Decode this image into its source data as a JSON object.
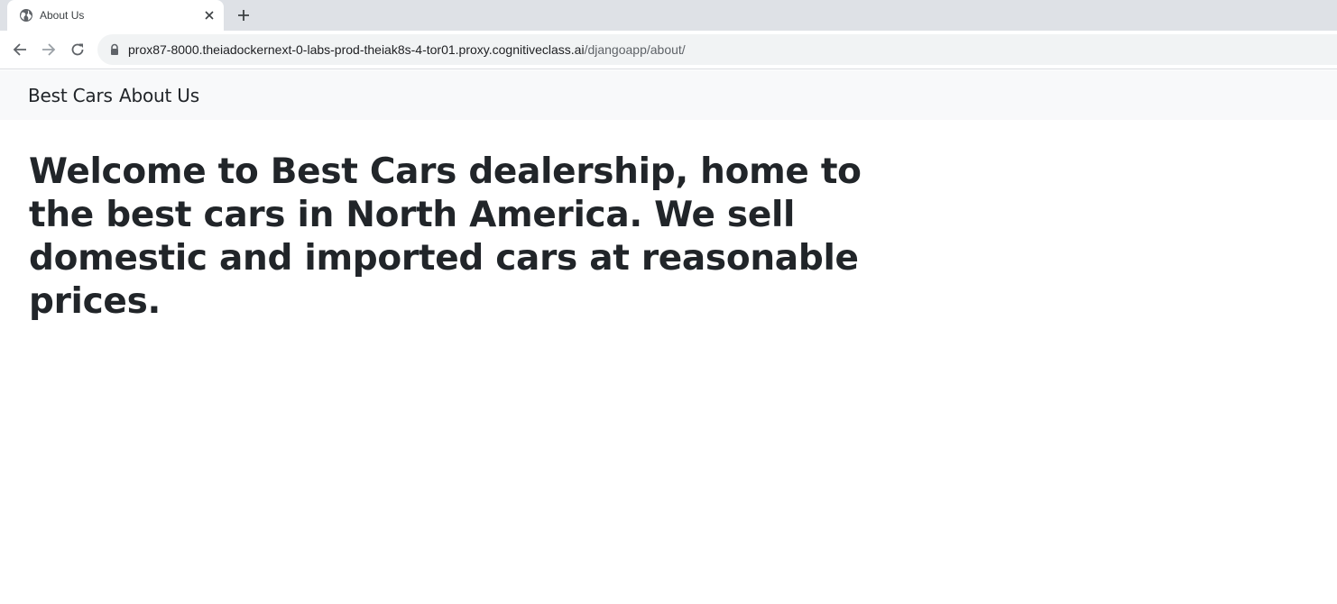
{
  "browser": {
    "tab": {
      "title": "About Us",
      "favicon": "globe-icon"
    },
    "new_tab_icon": "plus-icon",
    "toolbar": {
      "back_icon": "arrow-left-icon",
      "forward_icon": "arrow-right-icon",
      "reload_icon": "reload-icon",
      "security_icon": "lock-icon"
    },
    "address_bar": {
      "host": "prox87-8000.theiadockernext-0-labs-prod-theiak8s-4-tor01.proxy.cognitiveclass.ai",
      "path": "/djangoapp/about/"
    }
  },
  "page": {
    "navbar": {
      "brand": "Best Cars",
      "links": [
        "About Us"
      ]
    },
    "headline": "Welcome to Best Cars dealership, home to the best cars in North America. We sell domestic and imported cars at reasonable prices."
  },
  "colors": {
    "tabstrip_bg": "#dee1e6",
    "omnibox_bg": "#f1f3f4",
    "navbar_bg": "#f8f9fa",
    "text": "#212529"
  }
}
